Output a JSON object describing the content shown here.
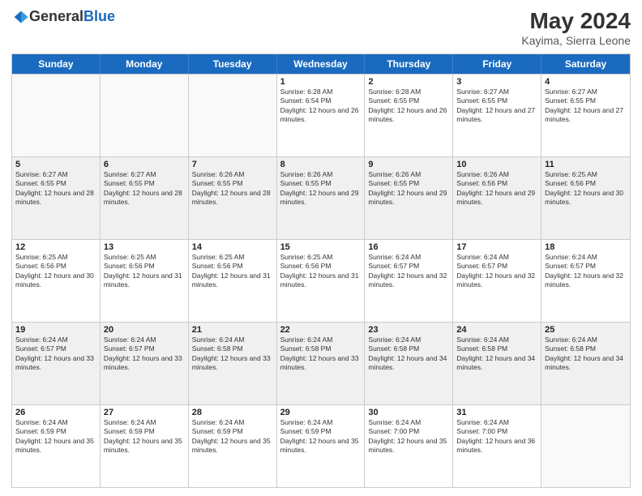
{
  "header": {
    "logo_general": "General",
    "logo_blue": "Blue",
    "title": "May 2024",
    "subtitle": "Kayima, Sierra Leone"
  },
  "calendar": {
    "days_of_week": [
      "Sunday",
      "Monday",
      "Tuesday",
      "Wednesday",
      "Thursday",
      "Friday",
      "Saturday"
    ],
    "rows": [
      [
        {
          "day": "",
          "info": "",
          "empty": true
        },
        {
          "day": "",
          "info": "",
          "empty": true
        },
        {
          "day": "",
          "info": "",
          "empty": true
        },
        {
          "day": "1",
          "info": "Sunrise: 6:28 AM\nSunset: 6:54 PM\nDaylight: 12 hours and 26 minutes."
        },
        {
          "day": "2",
          "info": "Sunrise: 6:28 AM\nSunset: 6:55 PM\nDaylight: 12 hours and 26 minutes."
        },
        {
          "day": "3",
          "info": "Sunrise: 6:27 AM\nSunset: 6:55 PM\nDaylight: 12 hours and 27 minutes."
        },
        {
          "day": "4",
          "info": "Sunrise: 6:27 AM\nSunset: 6:55 PM\nDaylight: 12 hours and 27 minutes."
        }
      ],
      [
        {
          "day": "5",
          "info": "Sunrise: 6:27 AM\nSunset: 6:55 PM\nDaylight: 12 hours and 28 minutes."
        },
        {
          "day": "6",
          "info": "Sunrise: 6:27 AM\nSunset: 6:55 PM\nDaylight: 12 hours and 28 minutes."
        },
        {
          "day": "7",
          "info": "Sunrise: 6:26 AM\nSunset: 6:55 PM\nDaylight: 12 hours and 28 minutes."
        },
        {
          "day": "8",
          "info": "Sunrise: 6:26 AM\nSunset: 6:55 PM\nDaylight: 12 hours and 29 minutes."
        },
        {
          "day": "9",
          "info": "Sunrise: 6:26 AM\nSunset: 6:55 PM\nDaylight: 12 hours and 29 minutes."
        },
        {
          "day": "10",
          "info": "Sunrise: 6:26 AM\nSunset: 6:56 PM\nDaylight: 12 hours and 29 minutes."
        },
        {
          "day": "11",
          "info": "Sunrise: 6:25 AM\nSunset: 6:56 PM\nDaylight: 12 hours and 30 minutes."
        }
      ],
      [
        {
          "day": "12",
          "info": "Sunrise: 6:25 AM\nSunset: 6:56 PM\nDaylight: 12 hours and 30 minutes."
        },
        {
          "day": "13",
          "info": "Sunrise: 6:25 AM\nSunset: 6:56 PM\nDaylight: 12 hours and 31 minutes."
        },
        {
          "day": "14",
          "info": "Sunrise: 6:25 AM\nSunset: 6:56 PM\nDaylight: 12 hours and 31 minutes."
        },
        {
          "day": "15",
          "info": "Sunrise: 6:25 AM\nSunset: 6:56 PM\nDaylight: 12 hours and 31 minutes."
        },
        {
          "day": "16",
          "info": "Sunrise: 6:24 AM\nSunset: 6:57 PM\nDaylight: 12 hours and 32 minutes."
        },
        {
          "day": "17",
          "info": "Sunrise: 6:24 AM\nSunset: 6:57 PM\nDaylight: 12 hours and 32 minutes."
        },
        {
          "day": "18",
          "info": "Sunrise: 6:24 AM\nSunset: 6:57 PM\nDaylight: 12 hours and 32 minutes."
        }
      ],
      [
        {
          "day": "19",
          "info": "Sunrise: 6:24 AM\nSunset: 6:57 PM\nDaylight: 12 hours and 33 minutes."
        },
        {
          "day": "20",
          "info": "Sunrise: 6:24 AM\nSunset: 6:57 PM\nDaylight: 12 hours and 33 minutes."
        },
        {
          "day": "21",
          "info": "Sunrise: 6:24 AM\nSunset: 6:58 PM\nDaylight: 12 hours and 33 minutes."
        },
        {
          "day": "22",
          "info": "Sunrise: 6:24 AM\nSunset: 6:58 PM\nDaylight: 12 hours and 33 minutes."
        },
        {
          "day": "23",
          "info": "Sunrise: 6:24 AM\nSunset: 6:58 PM\nDaylight: 12 hours and 34 minutes."
        },
        {
          "day": "24",
          "info": "Sunrise: 6:24 AM\nSunset: 6:58 PM\nDaylight: 12 hours and 34 minutes."
        },
        {
          "day": "25",
          "info": "Sunrise: 6:24 AM\nSunset: 6:58 PM\nDaylight: 12 hours and 34 minutes."
        }
      ],
      [
        {
          "day": "26",
          "info": "Sunrise: 6:24 AM\nSunset: 6:59 PM\nDaylight: 12 hours and 35 minutes."
        },
        {
          "day": "27",
          "info": "Sunrise: 6:24 AM\nSunset: 6:59 PM\nDaylight: 12 hours and 35 minutes."
        },
        {
          "day": "28",
          "info": "Sunrise: 6:24 AM\nSunset: 6:59 PM\nDaylight: 12 hours and 35 minutes."
        },
        {
          "day": "29",
          "info": "Sunrise: 6:24 AM\nSunset: 6:59 PM\nDaylight: 12 hours and 35 minutes."
        },
        {
          "day": "30",
          "info": "Sunrise: 6:24 AM\nSunset: 7:00 PM\nDaylight: 12 hours and 35 minutes."
        },
        {
          "day": "31",
          "info": "Sunrise: 6:24 AM\nSunset: 7:00 PM\nDaylight: 12 hours and 36 minutes."
        },
        {
          "day": "",
          "info": "",
          "empty": true
        }
      ]
    ]
  }
}
